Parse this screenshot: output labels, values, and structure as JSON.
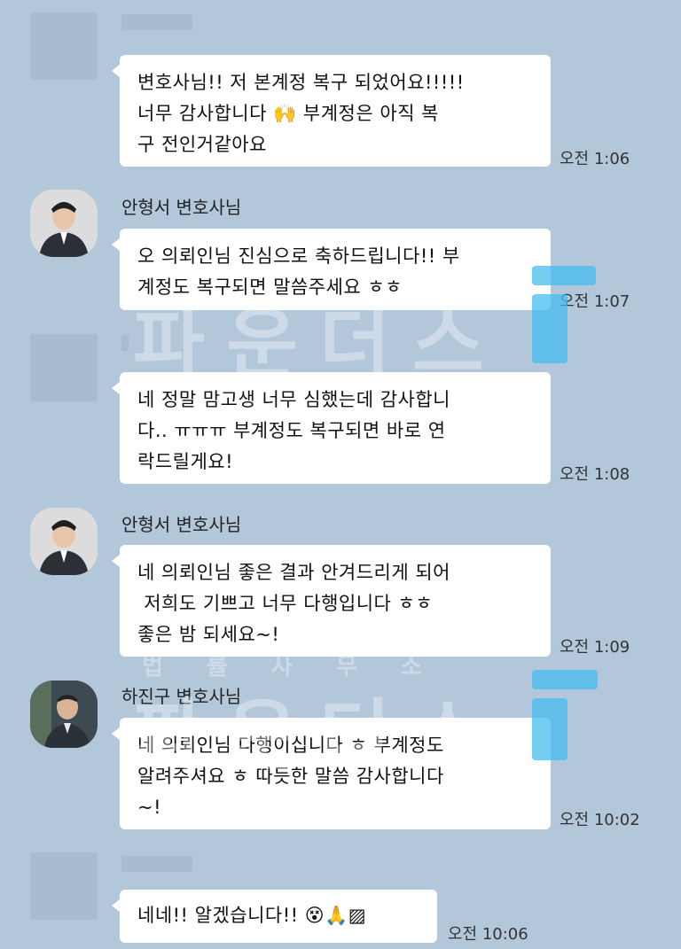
{
  "messages": [
    {
      "sender": "",
      "text": "변호사님!! 저 본계정 복구 되었어요!!!!!\n너무 감사합니다 🙌 부계정은 아직 복\n구 전인거같아요",
      "time": "오전 1:06"
    },
    {
      "sender": "안형서 변호사님",
      "text": "오 의뢰인님 진심으로 축하드립니다!! 부\n계정도 복구되면 말씀주세요 ㅎㅎ",
      "time": "오전 1:07"
    },
    {
      "sender": "",
      "text": "네 정말 맘고생 너무 심했는데 감사합니\n다.. ㅠㅠㅠ 부계정도 복구되면 바로 연\n락드릴게요!",
      "time": "오전 1:08"
    },
    {
      "sender": "안형서 변호사님",
      "text": "네 의뢰인님 좋은 결과 안겨드리게 되어\n 저희도 기쁘고 너무 다행입니다 ㅎㅎ\n좋은 밤 되세요~!",
      "time": "오전 1:09"
    },
    {
      "sender": "하진구 변호사님",
      "text": "네 의뢰인님 다행이십니다 ㅎ 부계정도\n알려주셔요 ㅎ 따듯한 말씀 감사합니다\n~!",
      "time": "오전 10:02"
    },
    {
      "sender": "",
      "text": "네네!! 알겠습니다!! 😵🙏▨",
      "time": "오전 10:06"
    }
  ],
  "watermark": {
    "title": "파운더스",
    "subtitle": "법 률 사 무 소"
  },
  "colors": {
    "background": "#b2c7da",
    "bubble": "#ffffff",
    "watermark_accent": "#46bef0"
  }
}
